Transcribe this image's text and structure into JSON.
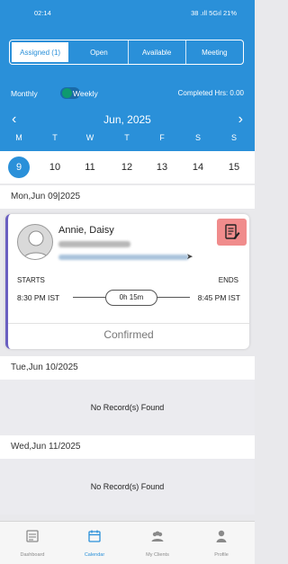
{
  "status_bar": {
    "time": "02:14",
    "right_text": "38 .ıll 5Gıl 21%"
  },
  "tabs": [
    {
      "label": "Assigned (1)",
      "active": true
    },
    {
      "label": "Open",
      "active": false
    },
    {
      "label": "Available",
      "active": false
    },
    {
      "label": "Meeting",
      "active": false
    }
  ],
  "view_toggle": {
    "monthly_label": "Monthly",
    "weekly_label": "Weekly",
    "weekly_selected": true,
    "completed_label": "Completed Hrs: 0.00"
  },
  "calendar": {
    "month_label": "Jun, 2025",
    "prev_icon": "chevron-left-icon",
    "next_icon": "chevron-right-icon",
    "weekdays": [
      "M",
      "T",
      "W",
      "T",
      "F",
      "S",
      "S"
    ],
    "dates": [
      "9",
      "10",
      "11",
      "12",
      "13",
      "14",
      "15"
    ],
    "selected_index": 0
  },
  "days": [
    {
      "header": "Mon,Jun 09|2025"
    },
    {
      "header": "Tue,Jun 10/2025",
      "empty_text": "No Record(s) Found"
    },
    {
      "header": "Wed,Jun 11/2025",
      "empty_text": "No Record(s) Found"
    }
  ],
  "appointment": {
    "client_name": "Annie, Daisy",
    "starts_label": "STARTS",
    "ends_label": "ENDS",
    "start_time": "8:30 PM IST",
    "end_time": "8:45 PM IST",
    "duration": "0h 15m",
    "status": "Confirmed",
    "accent_color": "#6a5fc1",
    "notes_button_color": "#f08c8c"
  },
  "bottom_nav": [
    {
      "label": "Dashboard",
      "icon": "dashboard-icon",
      "active": false
    },
    {
      "label": "Calendar",
      "icon": "calendar-icon",
      "active": true
    },
    {
      "label": "My Clients",
      "icon": "clients-icon",
      "active": false
    },
    {
      "label": "Profile",
      "icon": "profile-icon",
      "active": false
    }
  ],
  "colors": {
    "primary": "#2a90d9",
    "background": "#e9e9ec"
  }
}
